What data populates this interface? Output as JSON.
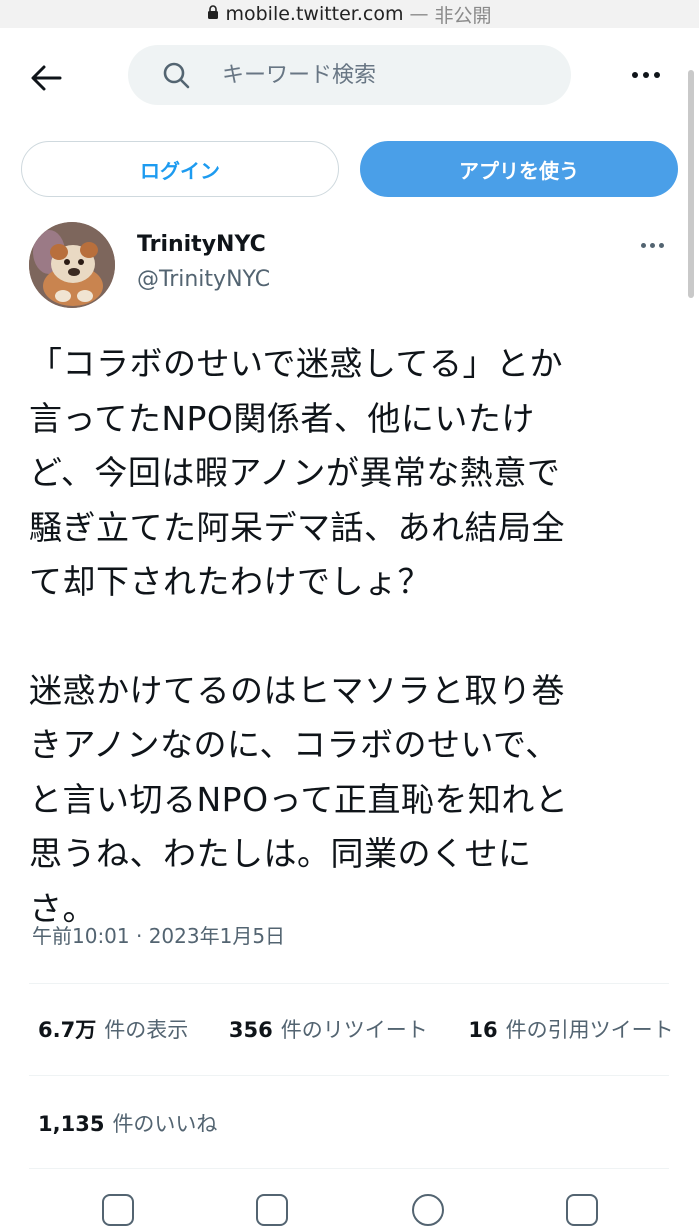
{
  "browser": {
    "domain": "mobile.twitter.com",
    "separator": "—",
    "privacy": "非公開"
  },
  "nav": {
    "search_placeholder": "キーワード検索"
  },
  "buttons": {
    "login": "ログイン",
    "app": "アプリを使う"
  },
  "user": {
    "name": "TrinityNYC",
    "handle": "@TrinityNYC"
  },
  "tweet": {
    "lines1": [
      "「コラボのせいで迷惑してる」とか",
      "言ってたNPO関係者、他にいたけ",
      "ど、今回は暇アノンが異常な熱意で",
      "騒ぎ立てた阿呆デマ話、あれ結局全",
      "て却下されたわけでしょ？"
    ],
    "lines2": [
      "迷惑かけてるのはヒマソラと取り巻",
      "きアノンなのに、コラボのせいで、",
      "と言い切るNPOって正直恥を知れと",
      "思うね、わたしは。同業のくせに",
      "さ。"
    ]
  },
  "timestamp": "午前10:01 · 2023年1月5日",
  "stats": {
    "views_count": "6.7万",
    "views_label": "件の表示",
    "retweets_count": "356",
    "retweets_label": "件のリツイート",
    "quotes_count": "16",
    "quotes_label": "件の引用ツイート",
    "likes_count": "1,135",
    "likes_label": "件のいいね"
  },
  "colors": {
    "accent": "#1d9bf0",
    "app_button": "#4a9fe8",
    "secondary_text": "#536471"
  }
}
